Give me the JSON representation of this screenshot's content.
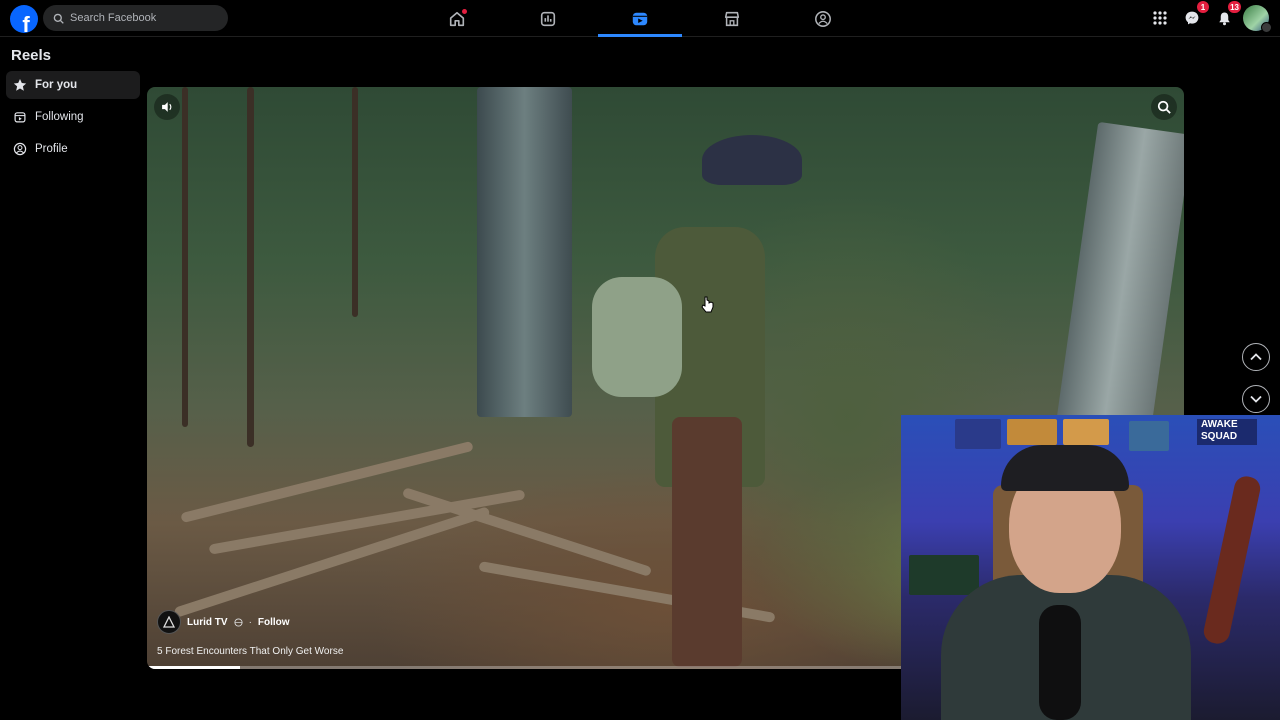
{
  "topbar": {
    "logo_letter": "f",
    "search_placeholder": "Search Facebook",
    "nav_tabs": [
      {
        "icon": "home-icon",
        "active": false
      },
      {
        "icon": "chart-icon",
        "active": false
      },
      {
        "icon": "reels-video-icon",
        "active": true
      },
      {
        "icon": "marketplace-icon",
        "active": false
      },
      {
        "icon": "groups-icon",
        "active": false
      }
    ],
    "messenger_badge": "1",
    "notifications_badge": "13",
    "accent_color": "#2d88ff"
  },
  "sidebar": {
    "title": "Reels",
    "items": [
      {
        "label": "For you",
        "icon": "star-icon",
        "active": true
      },
      {
        "label": "Following",
        "icon": "following-icon",
        "active": false
      },
      {
        "label": "Profile",
        "icon": "profile-icon",
        "active": false
      }
    ]
  },
  "reel": {
    "author": "Lurid TV",
    "separator": "·",
    "follow_label": "Follow",
    "title": "5 Forest Encounters That Only Get Worse",
    "progress": 0.09
  },
  "webcam": {
    "sign_line1": "AWAKE",
    "sign_line2": "SQUAD"
  }
}
